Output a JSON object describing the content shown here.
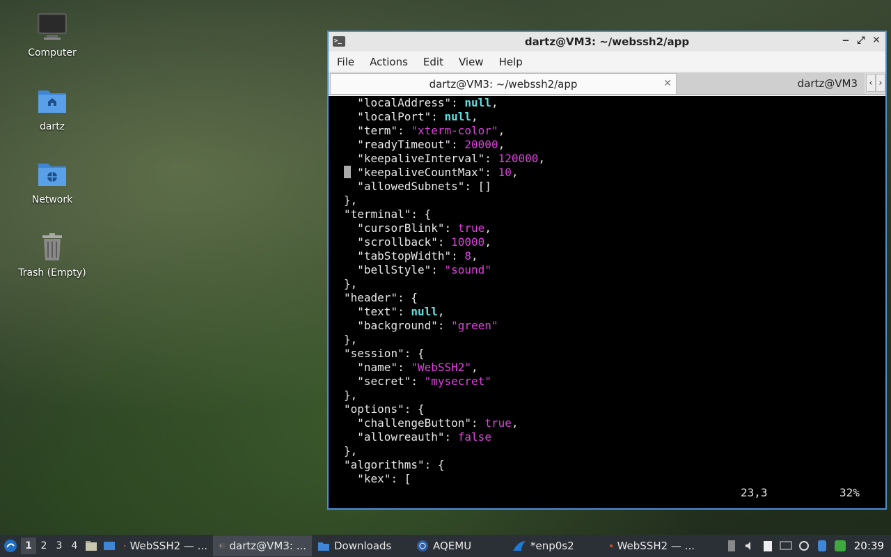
{
  "desktop": {
    "icons": [
      {
        "label": "Computer",
        "icon": "monitor-icon"
      },
      {
        "label": "dartz",
        "icon": "home-folder-icon"
      },
      {
        "label": "Network",
        "icon": "network-folder-icon"
      },
      {
        "label": "Trash (Empty)",
        "icon": "trash-icon"
      }
    ]
  },
  "window": {
    "title": "dartz@VM3: ~/webssh2/app",
    "menu": [
      "File",
      "Actions",
      "Edit",
      "View",
      "Help"
    ],
    "tabs": [
      {
        "label": "dartz@VM3: ~/webssh2/app",
        "active": true
      },
      {
        "label": "dartz@VM3",
        "active": false
      }
    ],
    "controls": {
      "minimize": "‒",
      "maximize": "⤢",
      "close": "✕"
    }
  },
  "terminal": {
    "lines": [
      [
        [
          "k",
          "  \""
        ],
        [
          "k",
          "localAddress"
        ],
        [
          "k",
          "\": "
        ],
        [
          "nl",
          "null"
        ],
        [
          "k",
          ","
        ]
      ],
      [
        [
          "k",
          "  \""
        ],
        [
          "k",
          "localPort"
        ],
        [
          "k",
          "\": "
        ],
        [
          "nl",
          "null"
        ],
        [
          "k",
          ","
        ]
      ],
      [
        [
          "k",
          "  \""
        ],
        [
          "k",
          "term"
        ],
        [
          "k",
          "\": "
        ],
        [
          "s",
          "\"xterm-color\""
        ],
        [
          "k",
          ","
        ]
      ],
      [
        [
          "k",
          "  \""
        ],
        [
          "k",
          "readyTimeout"
        ],
        [
          "k",
          "\": "
        ],
        [
          "n",
          "20000"
        ],
        [
          "k",
          ","
        ]
      ],
      [
        [
          "k",
          "  \""
        ],
        [
          "k",
          "keepaliveInterval"
        ],
        [
          "k",
          "\": "
        ],
        [
          "n",
          "120000"
        ],
        [
          "k",
          ","
        ]
      ],
      [
        [
          "k",
          "  \""
        ],
        [
          "k",
          "keepaliveCountMax"
        ],
        [
          "k",
          "\": "
        ],
        [
          "n",
          "10"
        ],
        [
          "k",
          ","
        ]
      ],
      [
        [
          "k",
          "  \""
        ],
        [
          "k",
          "allowedSubnets"
        ],
        [
          "k",
          "\": []"
        ]
      ],
      [
        [
          "k",
          "},"
        ]
      ],
      [
        [
          "k",
          "\""
        ],
        [
          "k",
          "terminal"
        ],
        [
          "k",
          "\": {"
        ]
      ],
      [
        [
          "k",
          "  \""
        ],
        [
          "k",
          "cursorBlink"
        ],
        [
          "k",
          "\": "
        ],
        [
          "b",
          "true"
        ],
        [
          "k",
          ","
        ]
      ],
      [
        [
          "k",
          "  \""
        ],
        [
          "k",
          "scrollback"
        ],
        [
          "k",
          "\": "
        ],
        [
          "n",
          "10000"
        ],
        [
          "k",
          ","
        ]
      ],
      [
        [
          "k",
          "  \""
        ],
        [
          "k",
          "tabStopWidth"
        ],
        [
          "k",
          "\": "
        ],
        [
          "n",
          "8"
        ],
        [
          "k",
          ","
        ]
      ],
      [
        [
          "k",
          "  \""
        ],
        [
          "k",
          "bellStyle"
        ],
        [
          "k",
          "\": "
        ],
        [
          "s",
          "\"sound\""
        ]
      ],
      [
        [
          "k",
          "},"
        ]
      ],
      [
        [
          "k",
          "\""
        ],
        [
          "k",
          "header"
        ],
        [
          "k",
          "\": {"
        ]
      ],
      [
        [
          "k",
          "  \""
        ],
        [
          "k",
          "text"
        ],
        [
          "k",
          "\": "
        ],
        [
          "nl",
          "null"
        ],
        [
          "k",
          ","
        ]
      ],
      [
        [
          "k",
          "  \""
        ],
        [
          "k",
          "background"
        ],
        [
          "k",
          "\": "
        ],
        [
          "s",
          "\"green\""
        ]
      ],
      [
        [
          "k",
          "},"
        ]
      ],
      [
        [
          "k",
          "\""
        ],
        [
          "k",
          "session"
        ],
        [
          "k",
          "\": {"
        ]
      ],
      [
        [
          "k",
          "  \""
        ],
        [
          "k",
          "name"
        ],
        [
          "k",
          "\": "
        ],
        [
          "s",
          "\"WebSSH2\""
        ],
        [
          "k",
          ","
        ]
      ],
      [
        [
          "k",
          "  \""
        ],
        [
          "k",
          "secret"
        ],
        [
          "k",
          "\": "
        ],
        [
          "s",
          "\"mysecret\""
        ]
      ],
      [
        [
          "k",
          "},"
        ]
      ],
      [
        [
          "k",
          "\""
        ],
        [
          "k",
          "options"
        ],
        [
          "k",
          "\": {"
        ]
      ],
      [
        [
          "k",
          "  \""
        ],
        [
          "k",
          "challengeButton"
        ],
        [
          "k",
          "\": "
        ],
        [
          "b",
          "true"
        ],
        [
          "k",
          ","
        ]
      ],
      [
        [
          "k",
          "  \""
        ],
        [
          "k",
          "allowreauth"
        ],
        [
          "k",
          "\": "
        ],
        [
          "b",
          "false"
        ]
      ],
      [
        [
          "k",
          "},"
        ]
      ],
      [
        [
          "k",
          "\""
        ],
        [
          "k",
          "algorithms"
        ],
        [
          "k",
          "\": {"
        ]
      ],
      [
        [
          "k",
          "  \""
        ],
        [
          "k",
          "kex"
        ],
        [
          "k",
          "\": ["
        ]
      ]
    ],
    "status_position": "23,3",
    "status_percent": "32%",
    "colors": {
      "background": "#000000",
      "text": "#e8e8e8",
      "string": "#e040e0",
      "null": "#60e0e0"
    }
  },
  "taskbar": {
    "workspaces": [
      "1",
      "2",
      "3",
      "4"
    ],
    "tasks": [
      {
        "label": "WebSSH2 — ...",
        "icon": "firefox-icon",
        "active": false
      },
      {
        "label": "dartz@VM3: ...",
        "icon": "terminal-icon",
        "active": true
      },
      {
        "label": "Downloads",
        "icon": "folder-icon",
        "active": false
      },
      {
        "label": "AQEMU",
        "icon": "aqemu-icon",
        "active": false
      },
      {
        "label": "*enp0s2",
        "icon": "wireshark-icon",
        "active": false
      },
      {
        "label": "WebSSH2 — ...",
        "icon": "firefox-icon",
        "active": false
      }
    ],
    "clock": "20:39"
  }
}
